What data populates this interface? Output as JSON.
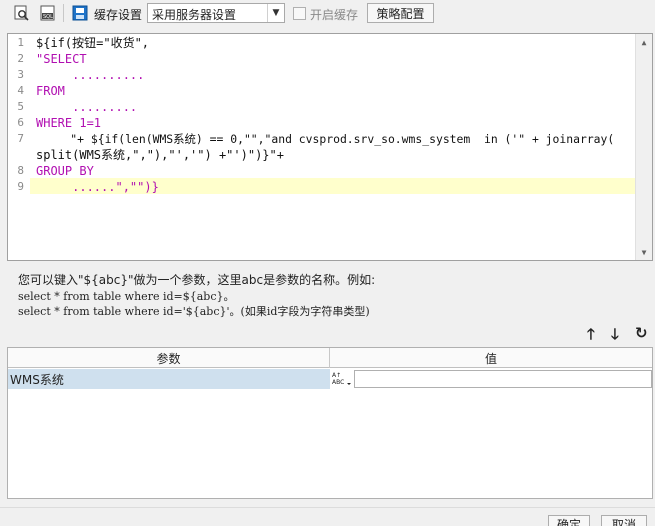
{
  "toolbar": {
    "cache_label": "缓存设置",
    "cache_select_value": "采用服务器设置",
    "enable_cache_label": "开启缓存",
    "strategy_button": "策略配置"
  },
  "editor": {
    "line_numbers": [
      "1",
      "2",
      "3",
      "4",
      "5",
      "6",
      "7",
      "8",
      "9"
    ],
    "lines": {
      "l1": "${if(按钮=\"收货\",",
      "l2": "\"SELECT",
      "l3": "     ..........",
      "l4": "FROM",
      "l5": "     .........",
      "l6": "WHERE 1=1",
      "l7": "     \"+ ${if(len(WMS系统) == 0,\"\",\"and cvsprod.srv_so.wms_system  in ('\" + joinarray(",
      "l8": "split(WMS系统,\",\"),\"','\") +\"')\")}\"+",
      "l9a": "GROUP BY",
      "l9b": "     ......\",\"\")}"
    }
  },
  "help": {
    "line1": "您可以键入\"${abc}\"做为一个参数，这里abc是参数的名称。例如:",
    "line2": "select * from table where id=${abc}。",
    "line3": "select * from table where id='${abc}'。(如果id字段为字符串类型)"
  },
  "controls": {
    "up": "🡑",
    "down": "🡓",
    "refresh": "↻"
  },
  "params": {
    "headers": [
      "参数",
      "值"
    ],
    "rows": [
      {
        "name": "WMS系统",
        "type_icon": "abc",
        "value": ""
      }
    ]
  },
  "footer": {
    "ok_button": "确定",
    "cancel_button": "取消"
  }
}
